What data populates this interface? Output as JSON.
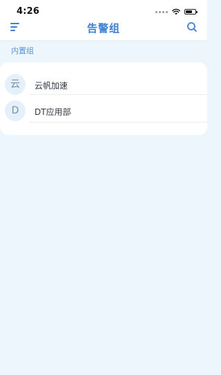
{
  "status_bar": {
    "time": "4:26"
  },
  "nav": {
    "title": "告警组",
    "menu_icon": "menu-icon",
    "search_icon": "search-icon"
  },
  "section": {
    "label": "内置组"
  },
  "groups": [
    {
      "avatar": "云",
      "name": "云帆加速"
    },
    {
      "avatar": "D",
      "name": "DT应用部"
    }
  ],
  "colors": {
    "accent": "#3d7fd6",
    "background": "#eef6fd",
    "avatar_bg": "#e4f0fb"
  }
}
